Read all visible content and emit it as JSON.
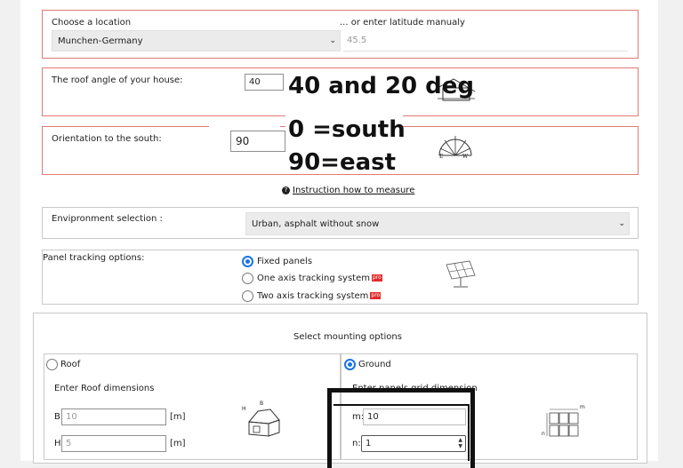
{
  "location": {
    "label": "Choose a location",
    "alt_label": "... or enter latitude manualy",
    "selected": "Munchen-Germany",
    "latitude_placeholder": "45.5"
  },
  "roof_angle": {
    "label": "The roof angle of your house:",
    "value": "40",
    "annotation": "40 and 20 deg"
  },
  "orientation": {
    "label": "Orientation to the south:",
    "value": "90",
    "annotation_1": "0 =south",
    "annotation_2": "90=east",
    "compass_e": "E",
    "compass_w": "W"
  },
  "instruction_link": "Instruction how to measure",
  "environment": {
    "label": "Envipronment selection :",
    "selected": "Urban, asphalt without snow"
  },
  "tracking": {
    "label": "Panel tracking options:",
    "options": [
      {
        "label": "Fixed panels",
        "selected": true,
        "badge": ""
      },
      {
        "label": "One axis tracking system",
        "selected": false,
        "badge": "pro"
      },
      {
        "label": "Two axis tracking system",
        "selected": false,
        "badge": "pro"
      }
    ]
  },
  "mounting": {
    "title": "Select mounting options",
    "roof": {
      "label": "Roof",
      "selected": false,
      "subtitle": "Enter Roof dimensions",
      "b_label": "B",
      "b_placeholder": "10",
      "h_label": "H",
      "h_placeholder": "5",
      "unit": "[m]",
      "icon_b": "B",
      "icon_h": "H"
    },
    "ground": {
      "label": "Ground",
      "selected": true,
      "subtitle": "Enter panels grid dimension",
      "m_label": "m:",
      "m_value": "10",
      "n_label": "n:",
      "n_value": "1",
      "icon_m": "m",
      "icon_n": "n"
    }
  },
  "colors": {
    "highlight_border": "#e07a74",
    "radio_selected": "#1a73e8",
    "pro_badge": "#e12b2b"
  }
}
